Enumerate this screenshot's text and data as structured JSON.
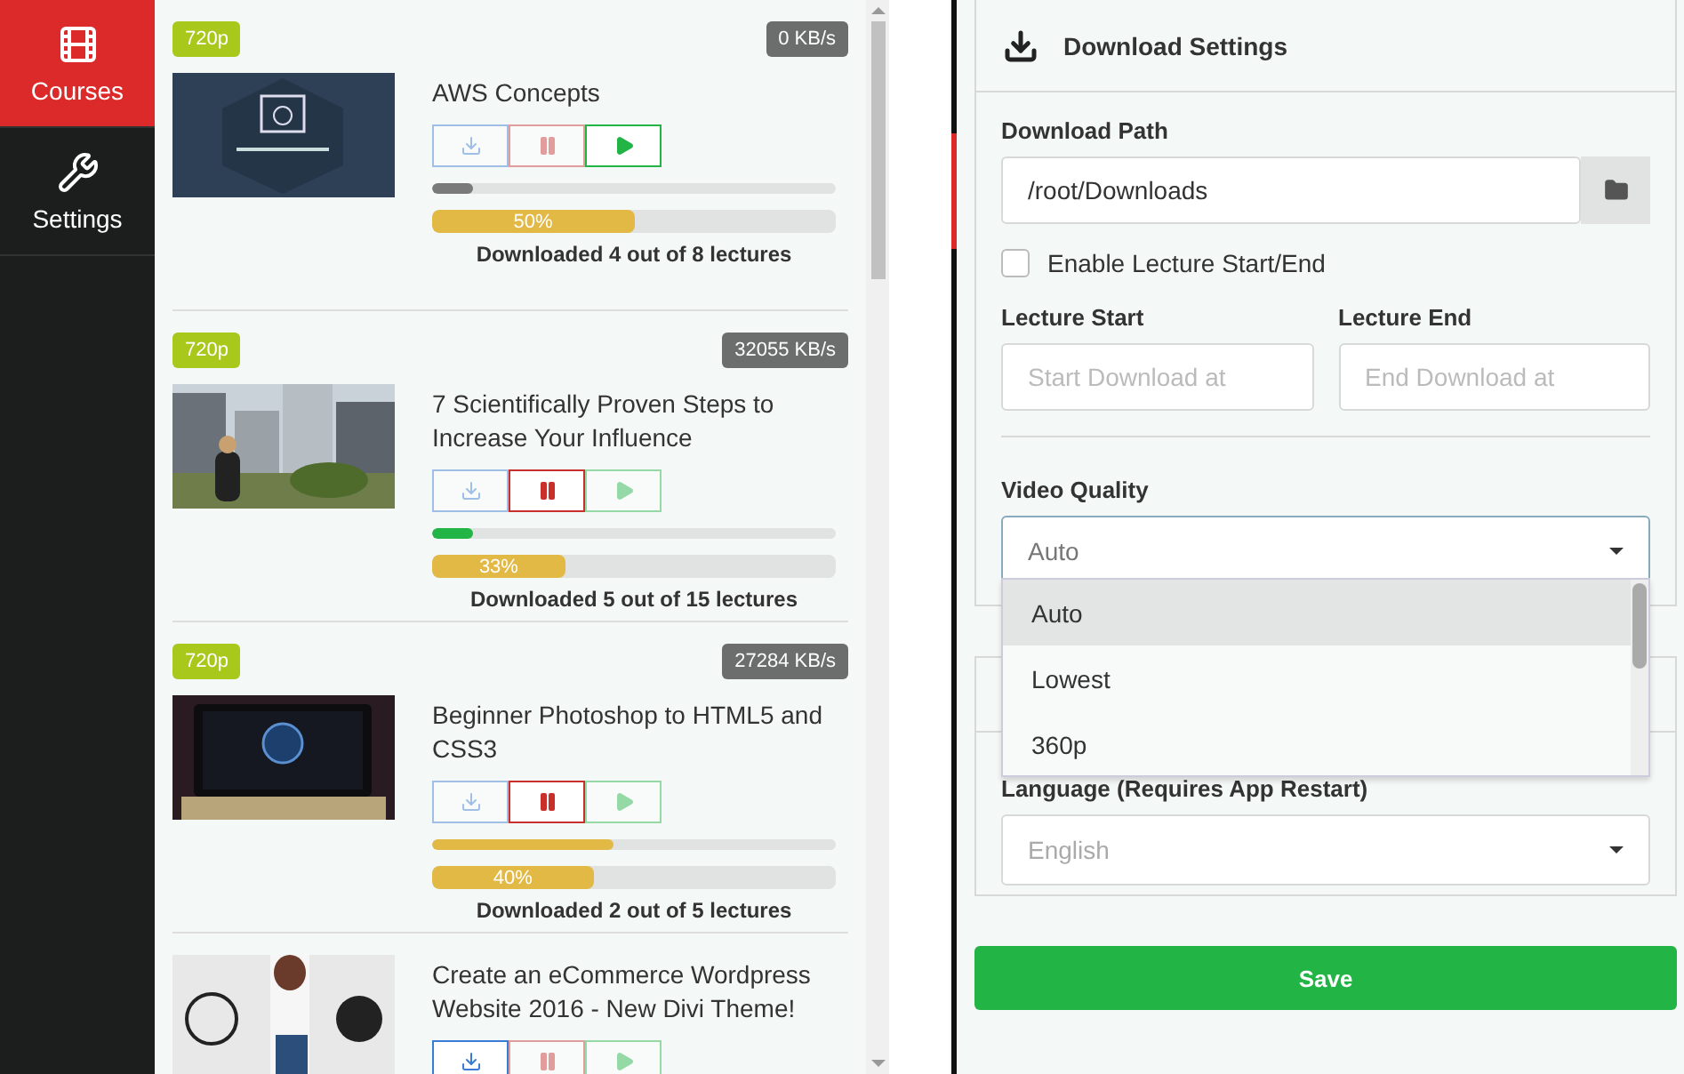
{
  "sidebar": {
    "items": [
      {
        "label": "Courses",
        "selected": true
      },
      {
        "label": "Settings",
        "selected": false
      }
    ]
  },
  "courses": [
    {
      "quality": "720p",
      "speed": "0 KB/s",
      "title": "AWS Concepts",
      "buttons": [
        {
          "kind": "download",
          "active": false
        },
        {
          "kind": "pause",
          "active": false
        },
        {
          "kind": "play",
          "active": true
        }
      ],
      "lecture_progress": {
        "level": 0.1,
        "color": "#7a7a7a"
      },
      "total_progress": {
        "level": 0.5,
        "label": "50%"
      },
      "caption": "Downloaded 4 out of 8 lectures"
    },
    {
      "quality": "720p",
      "speed": "32055 KB/s",
      "title": "7 Scientifically Proven Steps to Increase Your Influence",
      "buttons": [
        {
          "kind": "download",
          "active": false
        },
        {
          "kind": "pause",
          "active": true
        },
        {
          "kind": "play",
          "active": false
        }
      ],
      "lecture_progress": {
        "level": 0.1,
        "color": "#22b445"
      },
      "total_progress": {
        "level": 0.33,
        "label": "33%"
      },
      "caption": "Downloaded 5 out of 15 lectures"
    },
    {
      "quality": "720p",
      "speed": "27284 KB/s",
      "title": "Beginner Photoshop to HTML5 and CSS3",
      "buttons": [
        {
          "kind": "download",
          "active": false
        },
        {
          "kind": "pause",
          "active": true
        },
        {
          "kind": "play",
          "active": false
        }
      ],
      "lecture_progress": {
        "level": 0.45,
        "color": "#e3b946"
      },
      "total_progress": {
        "level": 0.4,
        "label": "40%"
      },
      "caption": "Downloaded 2 out of 5 lectures"
    },
    {
      "title": "Create an eCommerce Wordpress Website 2016 - New Divi Theme!",
      "buttons": [
        {
          "kind": "download",
          "active": true
        },
        {
          "kind": "pause",
          "active": false
        },
        {
          "kind": "play",
          "active": false
        }
      ]
    }
  ],
  "settings": {
    "title": "Download Settings",
    "download_path": {
      "label": "Download Path",
      "value": "/root/Downloads"
    },
    "lecture_range": {
      "label": "Enable Lecture Start/End",
      "checked": false
    },
    "lecture_start": {
      "label": "Lecture Start",
      "placeholder": "Start Download at"
    },
    "lecture_end": {
      "label": "Lecture End",
      "placeholder": "End Download at"
    },
    "video_quality": {
      "label": "Video Quality",
      "value": "Auto",
      "options": [
        {
          "label": "Auto",
          "selected": true
        },
        {
          "label": "Lowest",
          "selected": false
        },
        {
          "label": "360p",
          "selected": false
        }
      ]
    },
    "language": {
      "label": "Language (Requires App Restart)",
      "value": "English"
    },
    "save": "Save"
  }
}
